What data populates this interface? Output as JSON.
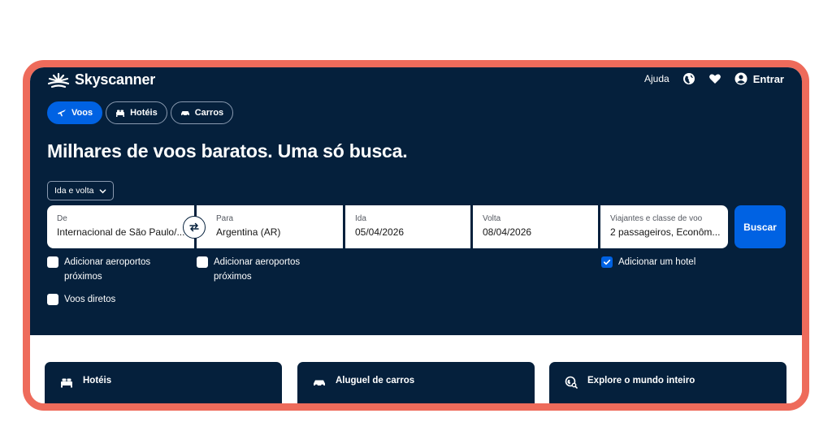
{
  "header": {
    "brand": "Skyscanner",
    "help": "Ajuda",
    "login": "Entrar",
    "icons": [
      "skyscanner-logo",
      "globe-icon",
      "heart-icon",
      "user-icon"
    ]
  },
  "tabs": [
    {
      "label": "Voos",
      "icon": "plane-icon",
      "active": true
    },
    {
      "label": "Hotéis",
      "icon": "bed-icon",
      "active": false
    },
    {
      "label": "Carros",
      "icon": "car-icon",
      "active": false
    }
  ],
  "headline": "Milhares de voos baratos. Uma só busca.",
  "trip_type": "Ida e volta",
  "search": {
    "from": {
      "label": "De",
      "value": "Internacional de São Paulo/..."
    },
    "to": {
      "label": "Para",
      "value": "Argentina (AR)"
    },
    "depart": {
      "label": "Ida",
      "value": "05/04/2026"
    },
    "return": {
      "label": "Volta",
      "value": "08/04/2026"
    },
    "travellers": {
      "label": "Viajantes e classe de voo",
      "value": "2 passageiros, Econôm..."
    },
    "button": "Buscar"
  },
  "options": {
    "nearby_origin": {
      "label": "Adicionar aeroportos próximos",
      "checked": false
    },
    "nearby_destination": {
      "label": "Adicionar aeroportos próximos",
      "checked": false
    },
    "add_hotel": {
      "label": "Adicionar um hotel",
      "checked": true
    },
    "direct_flights": {
      "label": "Voos diretos",
      "checked": false
    }
  },
  "cards": [
    {
      "label": "Hotéis",
      "icon": "bed-icon"
    },
    {
      "label": "Aluguel de carros",
      "icon": "car-icon"
    },
    {
      "label": "Explore o mundo inteiro",
      "icon": "explore-icon"
    }
  ],
  "colors": {
    "hero_background": "#05203c",
    "accent": "#0062e3",
    "frame_border": "#ee6b5b"
  }
}
